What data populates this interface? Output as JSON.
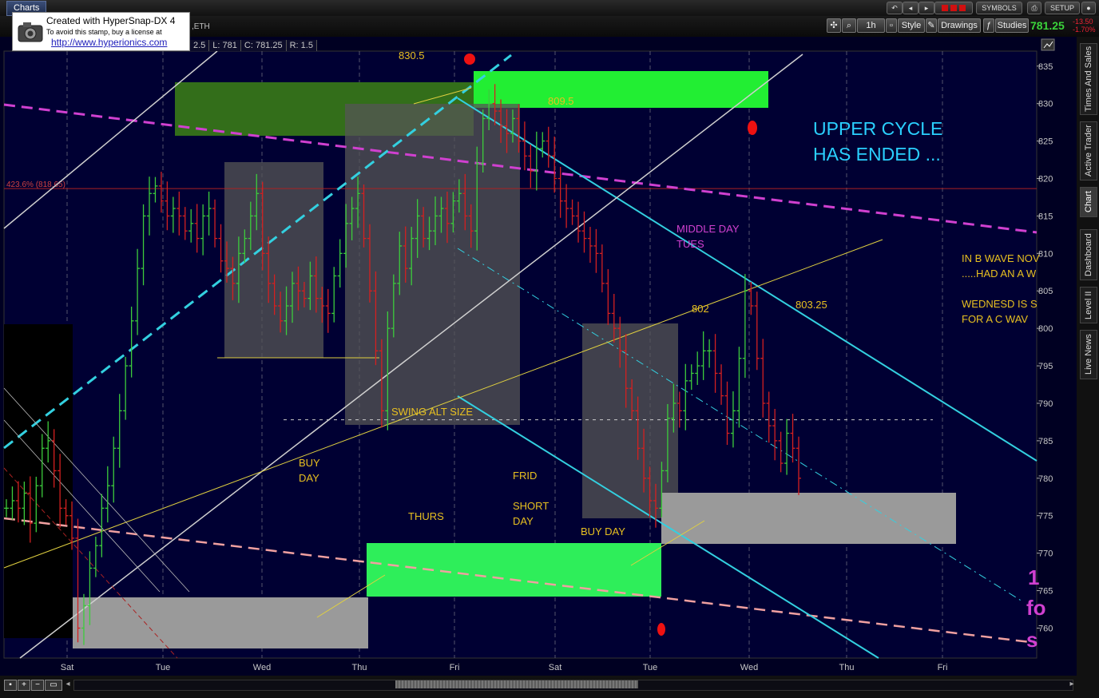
{
  "topbar": {
    "tab_label": "Charts",
    "symbols_label": "SYMBOLS",
    "setup_label": "SETUP"
  },
  "toolbar": {
    "timeframe": "1h",
    "style_label": "Style",
    "drawings_label": "Drawings",
    "studies_label": "Studies",
    "last_price": "781.25",
    "change_1": "-13.50",
    "change_2": "-1.70%"
  },
  "watermark": {
    "line1": "Created with HyperSnap-DX 4",
    "line2": "To avoid this stamp, buy a license at",
    "line3": "http://www.hyperionics.com"
  },
  "infoline": {
    "frag1": "2.5",
    "low": "L: 781",
    "close": "C: 781.25",
    "range": "R: 1.5",
    "symbol_suffix": ",ETH"
  },
  "side_tabs": [
    "Times And Sales",
    "Active Trader",
    "Chart",
    "Dashboard",
    "Level II",
    "Live News"
  ],
  "colors": {
    "background": "#000033",
    "bull": "#3ccc3c",
    "bear": "#d42020",
    "cyan": "#33d0e0",
    "magenta": "#d040d0",
    "pink": "#f0a0a0",
    "yellow": "#e0d040",
    "annotation": "#e8c020"
  },
  "chart_data": {
    "type": "candlestick",
    "interval": "1h",
    "ylim": [
      756,
      837
    ],
    "y_ticks": [
      835,
      830,
      825,
      820,
      815,
      810,
      805,
      800,
      795,
      790,
      785,
      780,
      775,
      770,
      765,
      760
    ],
    "x_labels": [
      "Sat",
      "Tue",
      "Wed",
      "Thu",
      "Fri",
      "Sat",
      "Tue",
      "Wed",
      "Thu",
      "Fri"
    ],
    "fib_label": "423.6% (818.65)",
    "fib_level": 818.65,
    "dotted_level": 787.8,
    "annotations": [
      {
        "text": "830.5",
        "color": "#e8c020"
      },
      {
        "text": "809.5",
        "color": "#e8c020"
      },
      {
        "text": "UPPER CYCLE",
        "color": "#2ad0ff"
      },
      {
        "text": "HAS ENDED ...",
        "color": "#2ad0ff"
      },
      {
        "text": "MIDDLE  DAY",
        "color": "#d040d0"
      },
      {
        "text": "TUES",
        "color": "#d040d0"
      },
      {
        "text": "IN B WAVE NOV",
        "color": "#e8c020"
      },
      {
        "text": ".....HAD AN A W",
        "color": "#e8c020"
      },
      {
        "text": "WEDNESD  IS S",
        "color": "#e8c020"
      },
      {
        "text": "FOR A C  WAV",
        "color": "#e8c020"
      },
      {
        "text": "802",
        "color": "#e8c020"
      },
      {
        "text": "803.25",
        "color": "#e8c020"
      },
      {
        "text": "SWING ALT SIZE",
        "color": "#e8c020"
      },
      {
        "text": "BUY",
        "color": "#e8c020"
      },
      {
        "text": "DAY",
        "color": "#e8c020"
      },
      {
        "text": "FRID",
        "color": "#e8c020"
      },
      {
        "text": "SHORT",
        "color": "#e8c020"
      },
      {
        "text": "DAY",
        "color": "#e8c020"
      },
      {
        "text": "THURS",
        "color": "#e8c020"
      },
      {
        "text": "BUY  DAY",
        "color": "#e8c020"
      },
      {
        "text": "1",
        "color": "#d040d0"
      },
      {
        "text": "fo",
        "color": "#d040d0"
      },
      {
        "text": "s",
        "color": "#d040d0"
      }
    ],
    "series": [
      {
        "name": "price",
        "values": [
          776,
          777,
          776,
          778,
          774,
          779,
          784,
          785,
          781,
          776,
          775,
          772,
          760,
          763,
          768,
          771,
          776,
          779,
          784,
          789,
          795,
          801,
          808,
          815,
          818,
          819,
          817,
          815,
          816,
          815,
          813,
          814,
          812,
          815,
          816,
          812,
          809,
          808,
          806,
          810,
          812,
          815,
          818,
          810,
          806,
          803,
          801,
          803,
          806,
          805,
          804,
          807,
          804,
          803,
          802,
          807,
          810,
          814,
          816,
          818,
          812,
          805,
          797,
          789,
          800,
          806,
          811,
          808,
          812,
          815,
          812,
          813,
          815,
          816,
          814,
          817,
          818,
          815,
          813,
          822,
          828,
          830,
          829,
          827,
          826,
          828,
          825,
          823,
          821,
          824,
          825,
          823,
          820,
          817,
          816,
          815,
          813,
          812,
          811,
          810,
          806,
          802,
          800,
          797,
          792,
          789,
          784,
          780,
          777,
          776,
          781,
          788,
          790,
          789,
          793,
          794,
          795,
          797,
          797,
          794,
          791,
          786,
          789,
          796,
          805,
          803,
          796,
          790,
          787,
          785,
          782,
          786,
          784,
          780
        ]
      }
    ]
  }
}
